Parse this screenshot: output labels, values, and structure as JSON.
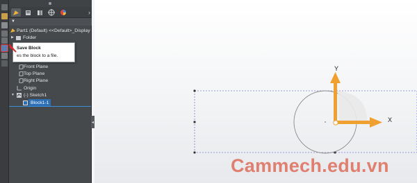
{
  "toolbar": {
    "icons": [
      "insert-block-icon",
      "edit-block-icon",
      "save-block-icon",
      "explode-block-icon"
    ]
  },
  "panel": {
    "tabs": [
      "feature-manager-icon",
      "property-manager-icon",
      "configuration-manager-icon",
      "dimxpert-icon",
      "display-manager-icon"
    ],
    "expand_glyph": "›",
    "filter_glyph": "▼"
  },
  "tree": {
    "root": "Part1 (Default) <<Default>_Display S",
    "folder": "Folder",
    "hidden_fragment": "d>",
    "front_plane": "Front Plane",
    "top_plane": "Top Plane",
    "right_plane": "Right Plane",
    "origin": "Origin",
    "sketch": "(-) Sketch1",
    "block": "Block1-1"
  },
  "tooltip": {
    "title": "Save Block",
    "description": "es the block to a file."
  },
  "graphics": {
    "x_axis_label": "X",
    "y_axis_label": "Y",
    "triad_color": "#f0a030",
    "sketch_color": "#7b7fd6"
  },
  "watermark": "Cammech.edu.vn"
}
